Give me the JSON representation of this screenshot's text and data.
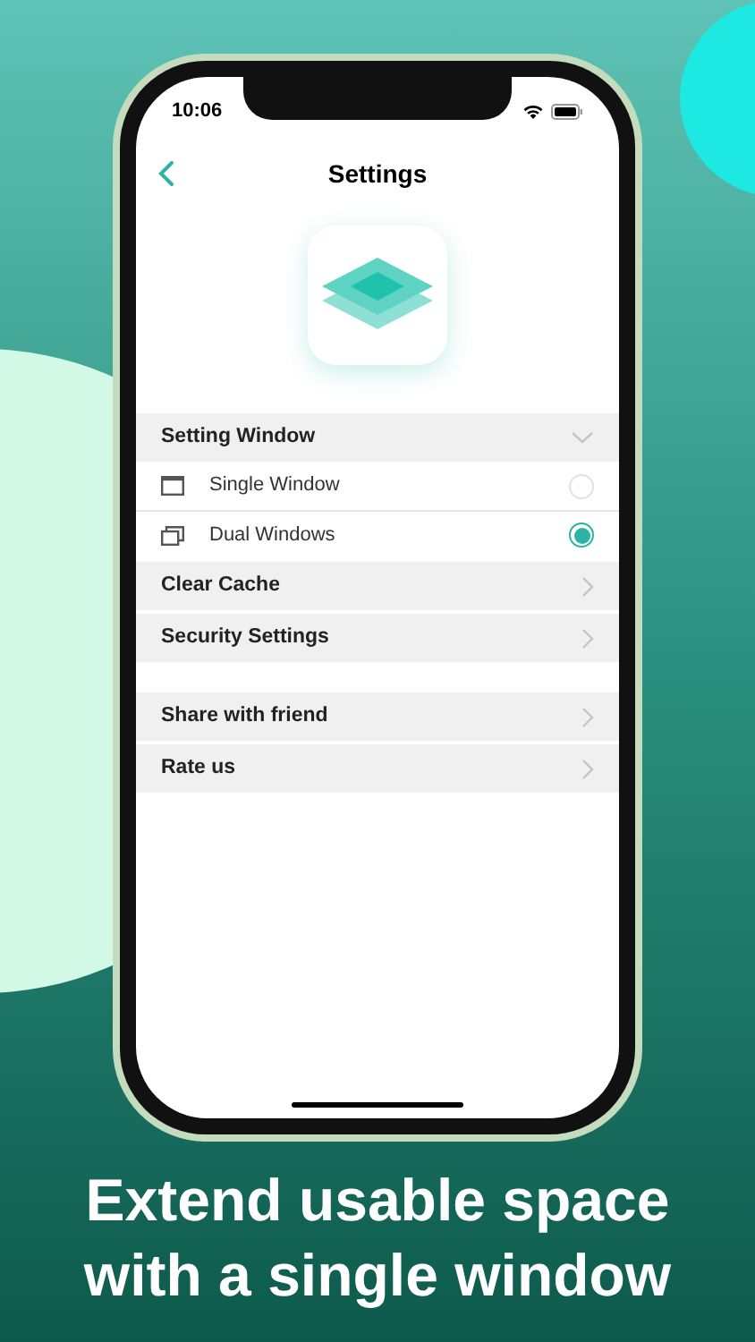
{
  "status_bar": {
    "time": "10:06"
  },
  "nav": {
    "title": "Settings"
  },
  "sections": [
    {
      "items": [
        {
          "kind": "header",
          "label": "Setting Window",
          "expanded": true
        },
        {
          "kind": "option",
          "label": "Single Window",
          "selected": false
        },
        {
          "kind": "option",
          "label": "Dual Windows",
          "selected": true
        },
        {
          "kind": "link",
          "label": "Clear Cache"
        },
        {
          "kind": "link",
          "label": "Security Settings"
        }
      ]
    },
    {
      "items": [
        {
          "kind": "link",
          "label": "Share with friend"
        },
        {
          "kind": "link",
          "label": "Rate us"
        }
      ]
    }
  ],
  "caption": [
    "Extend usable space",
    "with a single window"
  ]
}
